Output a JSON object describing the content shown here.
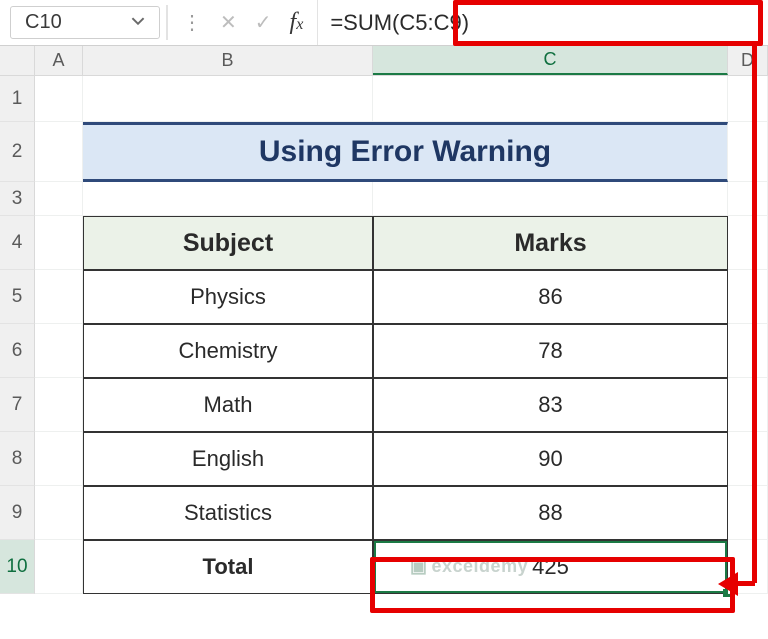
{
  "namebox": {
    "value": "C10"
  },
  "formula_bar": {
    "value": "=SUM(C5:C9)"
  },
  "columns": {
    "A": "A",
    "B": "B",
    "C": "C",
    "D": "D"
  },
  "rows": {
    "r1": "1",
    "r2": "2",
    "r3": "3",
    "r4": "4",
    "r5": "5",
    "r6": "6",
    "r7": "7",
    "r8": "8",
    "r9": "9",
    "r10": "10"
  },
  "title": "Using Error Warning",
  "table": {
    "headers": {
      "subject": "Subject",
      "marks": "Marks"
    },
    "rows": [
      {
        "subject": "Physics",
        "marks": "86"
      },
      {
        "subject": "Chemistry",
        "marks": "78"
      },
      {
        "subject": "Math",
        "marks": "83"
      },
      {
        "subject": "English",
        "marks": "90"
      },
      {
        "subject": "Statistics",
        "marks": "88"
      }
    ],
    "total_label": "Total",
    "total_value": "425"
  },
  "watermark": "exceldemy",
  "chart_data": {
    "type": "table",
    "title": "Using Error Warning",
    "columns": [
      "Subject",
      "Marks"
    ],
    "rows": [
      [
        "Physics",
        86
      ],
      [
        "Chemistry",
        78
      ],
      [
        "Math",
        83
      ],
      [
        "English",
        90
      ],
      [
        "Statistics",
        88
      ],
      [
        "Total",
        425
      ]
    ],
    "formula": "=SUM(C5:C9)",
    "active_cell": "C10"
  }
}
